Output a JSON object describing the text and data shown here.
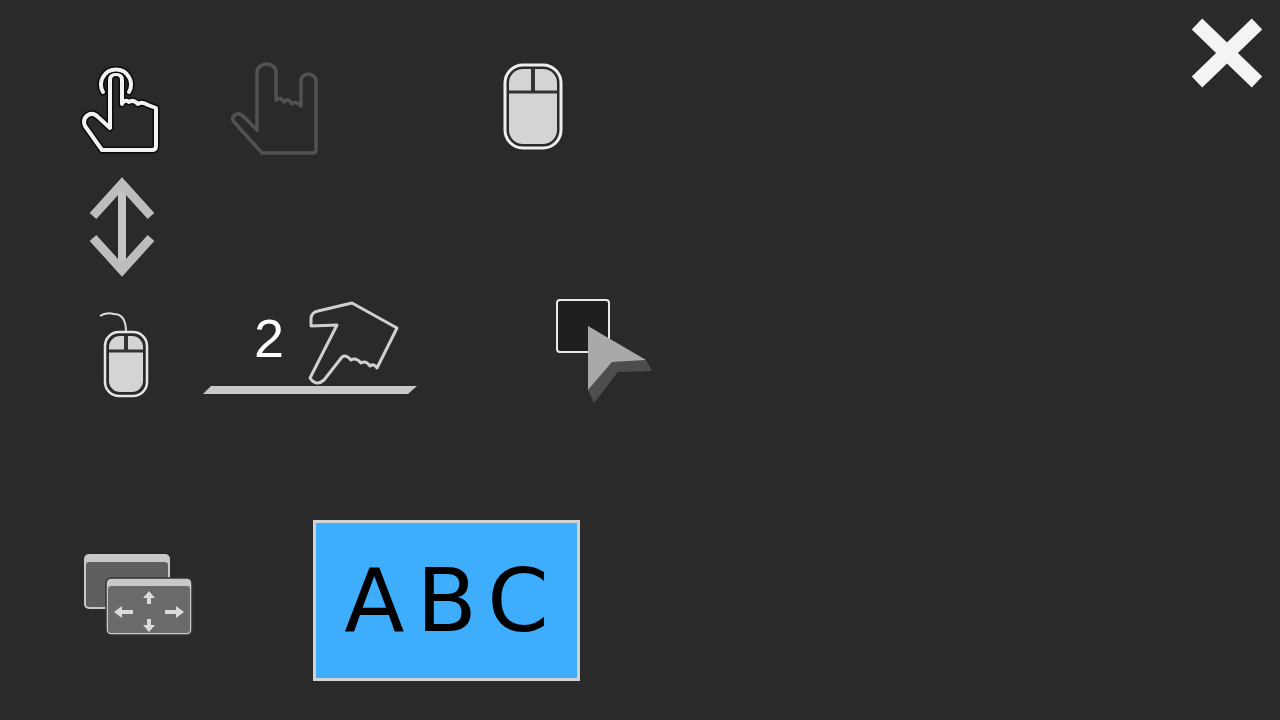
{
  "tools": [
    {
      "kind": "touch",
      "disabled": false
    },
    {
      "kind": "gesture",
      "disabled": true
    },
    {
      "kind": "mouse",
      "disabled": false
    },
    {
      "kind": "scroll",
      "disabled": false
    },
    {
      "kind": "wired",
      "disabled": false
    },
    {
      "kind": "tap",
      "label": "2",
      "disabled": false
    },
    {
      "kind": "cursor",
      "disabled": false
    },
    {
      "kind": "pan",
      "disabled": false
    },
    {
      "kind": "keyboard",
      "label": "ABC",
      "disabled": false
    }
  ]
}
